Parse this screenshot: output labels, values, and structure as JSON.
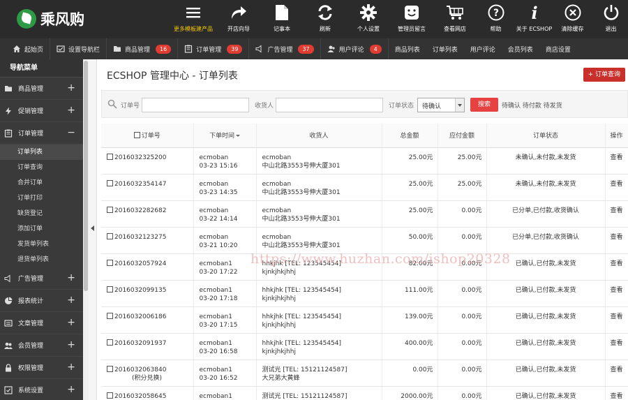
{
  "logo": {
    "text": "乘风购"
  },
  "toolbar": [
    {
      "label": "更多模板建产品",
      "icon": "menu-icon",
      "highlight": true
    },
    {
      "label": "开店向导",
      "icon": "share-arrow-icon"
    },
    {
      "label": "记事本",
      "icon": "notepad-icon"
    },
    {
      "label": "刷新",
      "icon": "refresh-icon"
    },
    {
      "label": "个人设置",
      "icon": "gear-icon"
    },
    {
      "label": "管理员留言",
      "icon": "smiley-icon"
    },
    {
      "label": "查看网店",
      "icon": "cart-icon"
    },
    {
      "label": "帮助",
      "icon": "help-icon"
    },
    {
      "label": "关于 ECSHOP",
      "icon": "info-icon"
    },
    {
      "label": "清除缓存",
      "icon": "close-circle-icon"
    },
    {
      "label": "退出",
      "icon": "power-icon"
    }
  ],
  "navbar": [
    {
      "label": "起始页",
      "icon": "home-icon"
    },
    {
      "label": "设置导航栏",
      "icon": "nav-settings-icon"
    },
    {
      "label": "商品管理",
      "icon": "folder-icon",
      "badge": "16"
    },
    {
      "label": "订单管理",
      "icon": "order-icon",
      "badge": "39"
    },
    {
      "label": "广告管理",
      "icon": "speaker-icon",
      "badge": "37"
    },
    {
      "label": "用户评论",
      "icon": "user-icon",
      "badge": "4"
    },
    {
      "label": "商品列表"
    },
    {
      "label": "订单列表"
    },
    {
      "label": "用户评论"
    },
    {
      "label": "会员列表"
    },
    {
      "label": "商店设置"
    }
  ],
  "sidebar": {
    "header": "导航菜单",
    "groups_top": [
      {
        "label": "商品管理",
        "icon": "folder-icon",
        "toggle": "+"
      },
      {
        "label": "促销管理",
        "icon": "bolt-icon",
        "toggle": "+"
      },
      {
        "label": "订单管理",
        "icon": "order-icon",
        "toggle": "−"
      }
    ],
    "subitems": [
      "订单列表",
      "订单查询",
      "合并订单",
      "订单打印",
      "缺货登记",
      "添加订单",
      "发货单列表",
      "退货单列表"
    ],
    "groups_bottom": [
      {
        "label": "广告管理",
        "icon": "speaker-icon",
        "toggle": "+"
      },
      {
        "label": "报表统计",
        "icon": "pie-chart-icon",
        "toggle": "+"
      },
      {
        "label": "文章管理",
        "icon": "article-icon",
        "toggle": "+"
      },
      {
        "label": "会员管理",
        "icon": "users-icon",
        "toggle": "+"
      },
      {
        "label": "权限管理",
        "icon": "lock-icon",
        "toggle": "+"
      },
      {
        "label": "系统设置",
        "icon": "settings-icon",
        "toggle": "+"
      }
    ]
  },
  "main": {
    "title": "ECSHOP 管理中心 - 订单列表",
    "query_button": "+ 订单查询",
    "search": {
      "order_no_label": "订单号",
      "order_no_value": "",
      "receiver_label": "收货人",
      "receiver_value": "",
      "status_label": "订单状态",
      "status_value": "待确认",
      "search_button": "搜索",
      "quick_links": "待确认 待付款 待发货"
    },
    "columns": [
      "订单号",
      "下单时间",
      "收货人",
      "总金额",
      "应付金额",
      "订单状态",
      "操作"
    ],
    "rows": [
      {
        "order_no": "2016032325200",
        "note": "",
        "buyer": "ecmoban",
        "time": "03-23 15:16",
        "receiver": "ecmoban",
        "address": "中山北路3553号伸大厦301",
        "total": "25.00元",
        "payable": "25.00元",
        "status": "未确认,未付款,未发货",
        "action": "查看"
      },
      {
        "order_no": "2016032354147",
        "note": "",
        "buyer": "ecmoban",
        "time": "03-23 14:35",
        "receiver": "ecmoban",
        "address": "中山北路3553号伸大厦301",
        "total": "25.00元",
        "payable": "25.00元",
        "status": "未确认,未付款,未发货",
        "action": "查看"
      },
      {
        "order_no": "2016032282682",
        "note": "",
        "buyer": "ecmoban",
        "time": "03-22 14:14",
        "receiver": "ecmoban",
        "address": "中山北路3553号伸大厦301",
        "total": "25.00元",
        "payable": "0.00元",
        "status": "已分单,已付款,收货确认",
        "action": "查看"
      },
      {
        "order_no": "2016032123275",
        "note": "",
        "buyer": "ecmoban",
        "time": "03-21 10:20",
        "receiver": "ecmoban",
        "address": "中山北路3553号伸大厦301",
        "total": "50.00元",
        "payable": "0.00元",
        "status": "已分单,已付款,收货确认",
        "action": "查看"
      },
      {
        "order_no": "2016032057924",
        "note": "",
        "buyer": "ecmoban1",
        "time": "03-20 17:22",
        "receiver": "hhkjhk [TEL: 123545454]",
        "address": "kjnkjhkjhhj",
        "total": "82.00元",
        "payable": "0.00元",
        "status": "已确认,已付款,未发货",
        "action": "查看"
      },
      {
        "order_no": "2016032099135",
        "note": "",
        "buyer": "ecmoban1",
        "time": "03-20 17:18",
        "receiver": "hhkjhk [TEL: 123545454]",
        "address": "kjnkjhkjhhj",
        "total": "111.00元",
        "payable": "0.00元",
        "status": "已确认,已付款,未发货",
        "action": "查看"
      },
      {
        "order_no": "2016032006186",
        "note": "",
        "buyer": "ecmoban1",
        "time": "03-20 17:15",
        "receiver": "hhkjhk [TEL: 123545454]",
        "address": "kjnkjhkjhhj",
        "total": "139.00元",
        "payable": "0.00元",
        "status": "已确认,已付款,未发货",
        "action": "查看"
      },
      {
        "order_no": "2016032091937",
        "note": "",
        "buyer": "ecmoban1",
        "time": "03-20 16:58",
        "receiver": "hhkjhk [TEL: 123545454]",
        "address": "kjnkjhkjhhj",
        "total": "400.00元",
        "payable": "0.00元",
        "status": "已确认,已付款,未发货",
        "action": "查看"
      },
      {
        "order_no": "2016032063840",
        "note": "(积分兑换)",
        "buyer": "ecmoban1",
        "time": "03-20 16:52",
        "receiver": "测试光 [TEL: 15121124587]",
        "address": "大兄弟大黄蜂",
        "total": "0.00元",
        "payable": "0.00元",
        "status": "已确认,已付款,未发货",
        "action": "查看"
      },
      {
        "order_no": "2016032058645",
        "note": "",
        "buyer": "ecmoban1",
        "time": "",
        "receiver": "测试光 [TEL: 15121124587]",
        "address": "",
        "total": "2000.00元",
        "payable": "0.00元",
        "status": "已确认,已付款,未发货",
        "action": "查看"
      }
    ]
  },
  "watermark": "https://www.huzhan.com/ishop20328",
  "colors": {
    "topbar": "#2b2b2b",
    "navbar": "#333333",
    "sidebar": "#3a3a3a",
    "accent": "#c9302c",
    "badge": "#e03c31",
    "logo": "#2e9a45",
    "highlight_text": "#f2c700"
  }
}
